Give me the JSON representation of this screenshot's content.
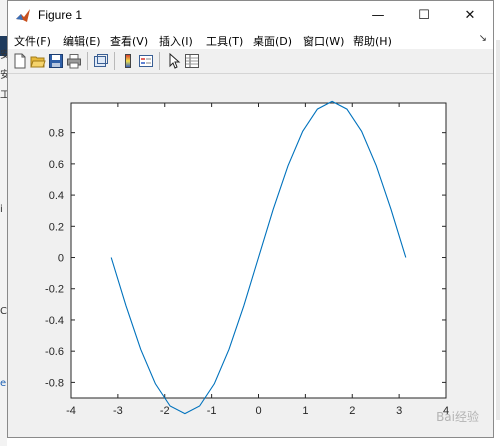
{
  "window": {
    "title": "Figure 1",
    "controls": {
      "minimize": "—",
      "maximize": "☐",
      "close": "✕"
    }
  },
  "menubar": {
    "items": [
      "文件(F)",
      "编辑(E)",
      "查看(V)",
      "插入(I)",
      "工具(T)",
      "桌面(D)",
      "窗口(W)",
      "帮助(H)"
    ],
    "overflow_arrow": "↘"
  },
  "toolbar": {
    "buttons": [
      "new-figure-icon",
      "open-file-icon",
      "save-icon",
      "print-icon",
      "link-plot-icon",
      "colorbar-icon",
      "legend-icon",
      "pointer-icon",
      "property-inspector-icon"
    ]
  },
  "watermark": "Bai经验",
  "background_app": {
    "left_edge_chars": [
      "安",
      "安",
      "工",
      "i",
      "C",
      "e"
    ]
  },
  "colors": {
    "line": "#0072bd",
    "axes_background": "#ffffff",
    "figure_background": "#f0f0f0"
  },
  "chart_data": {
    "type": "line",
    "title": "",
    "xlabel": "",
    "ylabel": "",
    "xlim": [
      -4,
      4
    ],
    "ylim": [
      -0.9,
      0.99
    ],
    "xticks": [
      "-4",
      "-3",
      "-2",
      "-1",
      "0",
      "1",
      "2",
      "3",
      "4"
    ],
    "xtick_values": [
      -4,
      -3,
      -2,
      -1,
      0,
      1,
      2,
      3,
      4
    ],
    "yticks": [
      "-0.8",
      "-0.6",
      "-0.4",
      "-0.2",
      "0",
      "0.2",
      "0.4",
      "0.6",
      "0.8"
    ],
    "ytick_values": [
      -0.8,
      -0.6,
      -0.4,
      -0.2,
      0,
      0.2,
      0.4,
      0.6,
      0.8
    ],
    "grid": false,
    "series": [
      {
        "x": [
          -3.1416,
          -2.8274,
          -2.5133,
          -2.1991,
          -1.885,
          -1.5708,
          -1.2566,
          -0.9425,
          -0.6283,
          -0.3142,
          0,
          0.3142,
          0.6283,
          0.9425,
          1.2566,
          1.5708,
          1.885,
          2.1991,
          2.5133,
          2.8274,
          3.1416
        ],
        "y": [
          0,
          -0.309,
          -0.5878,
          -0.809,
          -0.9511,
          -1.0,
          -0.9511,
          -0.809,
          -0.5878,
          -0.309,
          0,
          0.309,
          0.5878,
          0.809,
          0.9511,
          1.0,
          0.9511,
          0.809,
          0.5878,
          0.309,
          0
        ]
      }
    ]
  }
}
